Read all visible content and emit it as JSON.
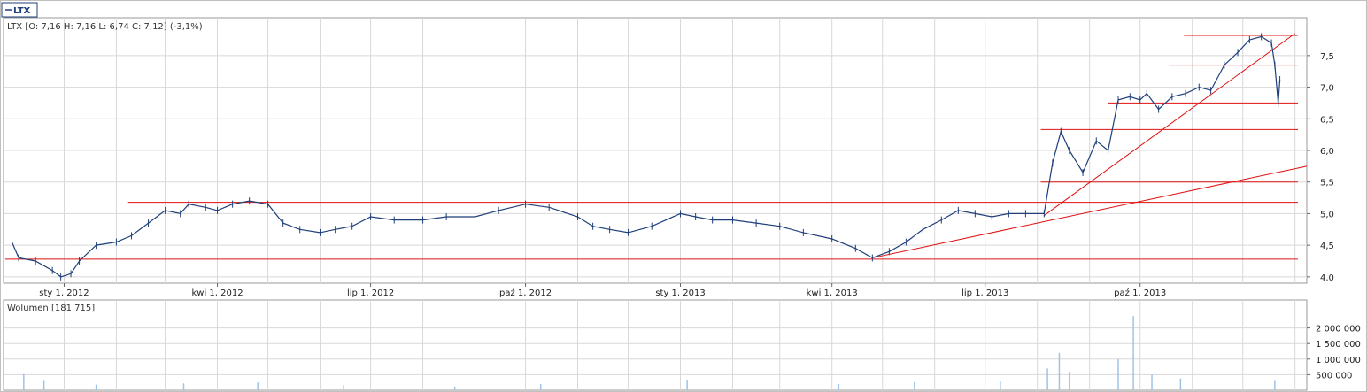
{
  "legend": {
    "ticker": "LTX"
  },
  "colors": {
    "price": "#1f3f7a",
    "trend": "#e01010",
    "grid": "#d8d8d8",
    "frame": "#a0a0a0",
    "volume": "#9fc3e6"
  },
  "chart_data": [
    {
      "type": "line",
      "title": "LTX [O: 7,16  H: 7,16  L: 6,74  C: 7,12] (-3,1%)",
      "x_ticks": [
        "sty 1, 2012",
        "kwi 1, 2012",
        "lip 1, 2012",
        "paź 1, 2012",
        "sty 1, 2013",
        "kwi 1, 2013",
        "lip 1, 2013",
        "paź 1, 2013"
      ],
      "y_ticks": [
        "4,0",
        "4,5",
        "5,0",
        "5,5",
        "6,0",
        "6,5",
        "7,0",
        "7,5"
      ],
      "ylim": [
        3.9,
        8.1
      ],
      "xlim": [
        "2011-11-26",
        "2014-01-08"
      ],
      "grid": true,
      "series": [
        {
          "name": "LTX",
          "points": [
            [
              "2011-12-01",
              4.55
            ],
            [
              "2011-12-05",
              4.3
            ],
            [
              "2011-12-15",
              4.25
            ],
            [
              "2011-12-25",
              4.1
            ],
            [
              "2011-12-30",
              4.0
            ],
            [
              "2012-01-05",
              4.05
            ],
            [
              "2012-01-10",
              4.25
            ],
            [
              "2012-01-20",
              4.5
            ],
            [
              "2012-02-01",
              4.55
            ],
            [
              "2012-02-10",
              4.65
            ],
            [
              "2012-02-20",
              4.85
            ],
            [
              "2012-03-01",
              5.05
            ],
            [
              "2012-03-10",
              5.0
            ],
            [
              "2012-03-15",
              5.15
            ],
            [
              "2012-03-25",
              5.1
            ],
            [
              "2012-04-01",
              5.05
            ],
            [
              "2012-04-10",
              5.15
            ],
            [
              "2012-04-20",
              5.2
            ],
            [
              "2012-05-01",
              5.15
            ],
            [
              "2012-05-10",
              4.85
            ],
            [
              "2012-05-20",
              4.75
            ],
            [
              "2012-06-01",
              4.7
            ],
            [
              "2012-06-10",
              4.75
            ],
            [
              "2012-06-20",
              4.8
            ],
            [
              "2012-07-01",
              4.95
            ],
            [
              "2012-07-15",
              4.9
            ],
            [
              "2012-08-01",
              4.9
            ],
            [
              "2012-08-15",
              4.95
            ],
            [
              "2012-09-01",
              4.95
            ],
            [
              "2012-09-15",
              5.05
            ],
            [
              "2012-10-01",
              5.15
            ],
            [
              "2012-10-15",
              5.1
            ],
            [
              "2012-11-01",
              4.95
            ],
            [
              "2012-11-10",
              4.8
            ],
            [
              "2012-11-20",
              4.75
            ],
            [
              "2012-12-01",
              4.7
            ],
            [
              "2012-12-15",
              4.8
            ],
            [
              "2013-01-01",
              5.0
            ],
            [
              "2013-01-10",
              4.95
            ],
            [
              "2013-01-20",
              4.9
            ],
            [
              "2013-02-01",
              4.9
            ],
            [
              "2013-02-15",
              4.85
            ],
            [
              "2013-03-01",
              4.8
            ],
            [
              "2013-03-15",
              4.7
            ],
            [
              "2013-04-01",
              4.6
            ],
            [
              "2013-04-15",
              4.45
            ],
            [
              "2013-04-25",
              4.3
            ],
            [
              "2013-05-05",
              4.4
            ],
            [
              "2013-05-15",
              4.55
            ],
            [
              "2013-05-25",
              4.75
            ],
            [
              "2013-06-05",
              4.9
            ],
            [
              "2013-06-15",
              5.05
            ],
            [
              "2013-06-25",
              5.0
            ],
            [
              "2013-07-05",
              4.95
            ],
            [
              "2013-07-15",
              5.0
            ],
            [
              "2013-07-25",
              5.0
            ],
            [
              "2013-08-05",
              5.0
            ],
            [
              "2013-08-10",
              5.8
            ],
            [
              "2013-08-15",
              6.3
            ],
            [
              "2013-08-20",
              6.0
            ],
            [
              "2013-08-28",
              5.65
            ],
            [
              "2013-09-05",
              6.15
            ],
            [
              "2013-09-12",
              6.0
            ],
            [
              "2013-09-18",
              6.8
            ],
            [
              "2013-09-25",
              6.85
            ],
            [
              "2013-10-01",
              6.8
            ],
            [
              "2013-10-05",
              6.9
            ],
            [
              "2013-10-12",
              6.65
            ],
            [
              "2013-10-20",
              6.85
            ],
            [
              "2013-10-28",
              6.9
            ],
            [
              "2013-11-05",
              7.0
            ],
            [
              "2013-11-12",
              6.95
            ],
            [
              "2013-11-20",
              7.35
            ],
            [
              "2013-11-28",
              7.55
            ],
            [
              "2013-12-05",
              7.75
            ],
            [
              "2013-12-12",
              7.8
            ],
            [
              "2013-12-18",
              7.7
            ],
            [
              "2013-12-20",
              7.35
            ],
            [
              "2013-12-22",
              6.74
            ],
            [
              "2013-12-23",
              7.12
            ]
          ]
        }
      ],
      "annotations": {
        "horizontal_lines": [
          4.28,
          5.18,
          5.5,
          6.33,
          6.75,
          7.35,
          7.82
        ],
        "trend_lines": [
          {
            "from": [
              "2013-04-25",
              4.3
            ],
            "to": [
              "2014-01-08",
              5.75
            ]
          },
          {
            "from": [
              "2013-08-05",
              4.97
            ],
            "to": [
              "2014-01-01",
              7.85
            ]
          }
        ]
      }
    },
    {
      "type": "bar",
      "title": "Wolumen [181 715]",
      "y_ticks": [
        "500 000",
        "1 000 000",
        "1 500 000",
        "2 000 000"
      ],
      "ylim": [
        0,
        2500000
      ],
      "series": [
        {
          "name": "Wolumen",
          "points": [
            [
              "2011-12-08",
              520000
            ],
            [
              "2011-12-20",
              300000
            ],
            [
              "2012-01-20",
              180000
            ],
            [
              "2012-03-12",
              220000
            ],
            [
              "2012-04-25",
              250000
            ],
            [
              "2012-06-15",
              160000
            ],
            [
              "2012-08-20",
              120000
            ],
            [
              "2012-10-10",
              200000
            ],
            [
              "2013-01-05",
              330000
            ],
            [
              "2013-04-05",
              200000
            ],
            [
              "2013-05-20",
              260000
            ],
            [
              "2013-07-10",
              280000
            ],
            [
              "2013-08-07",
              700000
            ],
            [
              "2013-08-14",
              1200000
            ],
            [
              "2013-08-20",
              600000
            ],
            [
              "2013-09-18",
              1000000
            ],
            [
              "2013-09-27",
              2380000
            ],
            [
              "2013-10-08",
              500000
            ],
            [
              "2013-10-25",
              380000
            ],
            [
              "2013-12-20",
              300000
            ]
          ]
        }
      ]
    }
  ]
}
